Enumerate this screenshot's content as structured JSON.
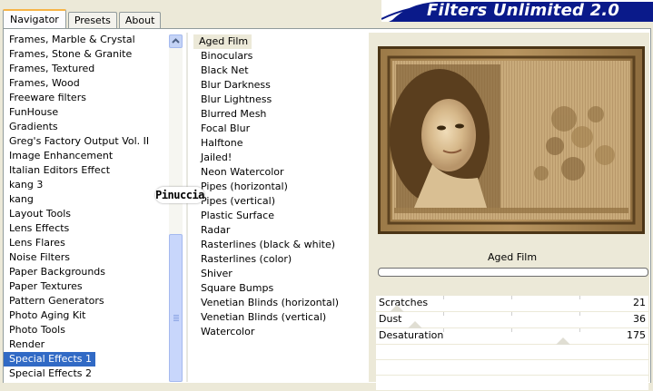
{
  "tabs": [
    "Navigator",
    "Presets",
    "About"
  ],
  "title": "Filters Unlimited 2.0",
  "categories": [
    "Frames, Marble & Crystal",
    "Frames, Stone & Granite",
    "Frames, Textured",
    "Frames, Wood",
    "Freeware filters",
    "FunHouse",
    "Gradients",
    "Greg's Factory Output Vol. II",
    "Image Enhancement",
    "Italian Editors Effect",
    "kang 3",
    "kang",
    "Layout Tools",
    "Lens Effects",
    "Lens Flares",
    "Noise Filters",
    "Paper Backgrounds",
    "Paper Textures",
    "Pattern Generators",
    "Photo Aging Kit",
    "Photo Tools",
    "Render",
    "Special Effects 1",
    "Special Effects 2"
  ],
  "selected_category": "Special Effects 1",
  "filters": [
    "Aged Film",
    "Binoculars",
    "Black Net",
    "Blur Darkness",
    "Blur Lightness",
    "Blurred Mesh",
    "Focal Blur",
    "Halftone",
    "Jailed!",
    "Neon Watercolor",
    "Pipes (horizontal)",
    "Pipes (vertical)",
    "Plastic Surface",
    "Radar",
    "Rasterlines (black & white)",
    "Rasterlines (color)",
    "Shiver",
    "Square Bumps",
    "Venetian Blinds (horizontal)",
    "Venetian Blinds (vertical)",
    "Watercolor"
  ],
  "selected_filter": "Aged Film",
  "current_filter_label": "Aged Film",
  "watermark": "Pinuccia",
  "parameters": [
    {
      "name": "Scratches",
      "value": "21"
    },
    {
      "name": "Dust",
      "value": "36"
    },
    {
      "name": "Desaturation",
      "value": "175"
    }
  ],
  "colors": {
    "title_bar": "#0a1a8a",
    "selection": "#316ac5",
    "sepia_frame": "#8a6a3c"
  }
}
